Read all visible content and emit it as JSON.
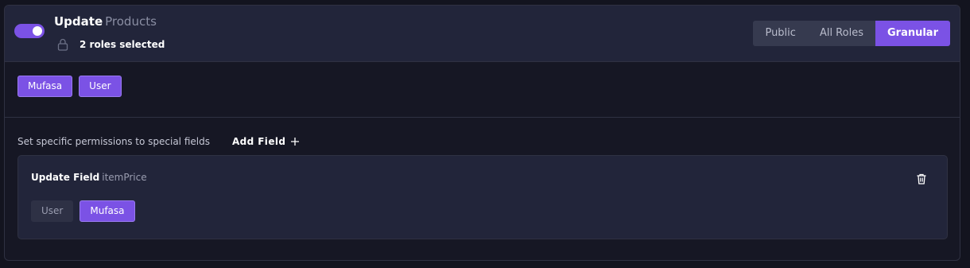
{
  "header": {
    "action": "Update",
    "entity": "Products",
    "selected_roles": "2 roles selected",
    "toggle_on": true,
    "visibility_options": [
      "Public",
      "All Roles",
      "Granular"
    ],
    "active_visibility": "Granular"
  },
  "roles": [
    {
      "label": "Mufasa",
      "selected": true
    },
    {
      "label": "User",
      "selected": true
    }
  ],
  "permissions": {
    "description": "Set specific permissions to special fields",
    "add_field_label": "Add Field",
    "fields": [
      {
        "title": "Update Field",
        "field_name": "itemPrice",
        "roles": [
          {
            "label": "User",
            "selected": false
          },
          {
            "label": "Mufasa",
            "selected": true
          }
        ]
      }
    ]
  },
  "icons": {
    "lock": "lock-icon",
    "plus": "plus-icon",
    "trash": "trash-icon"
  },
  "colors": {
    "accent": "#7b52e5",
    "panel": "#22253a",
    "background": "#161724"
  }
}
